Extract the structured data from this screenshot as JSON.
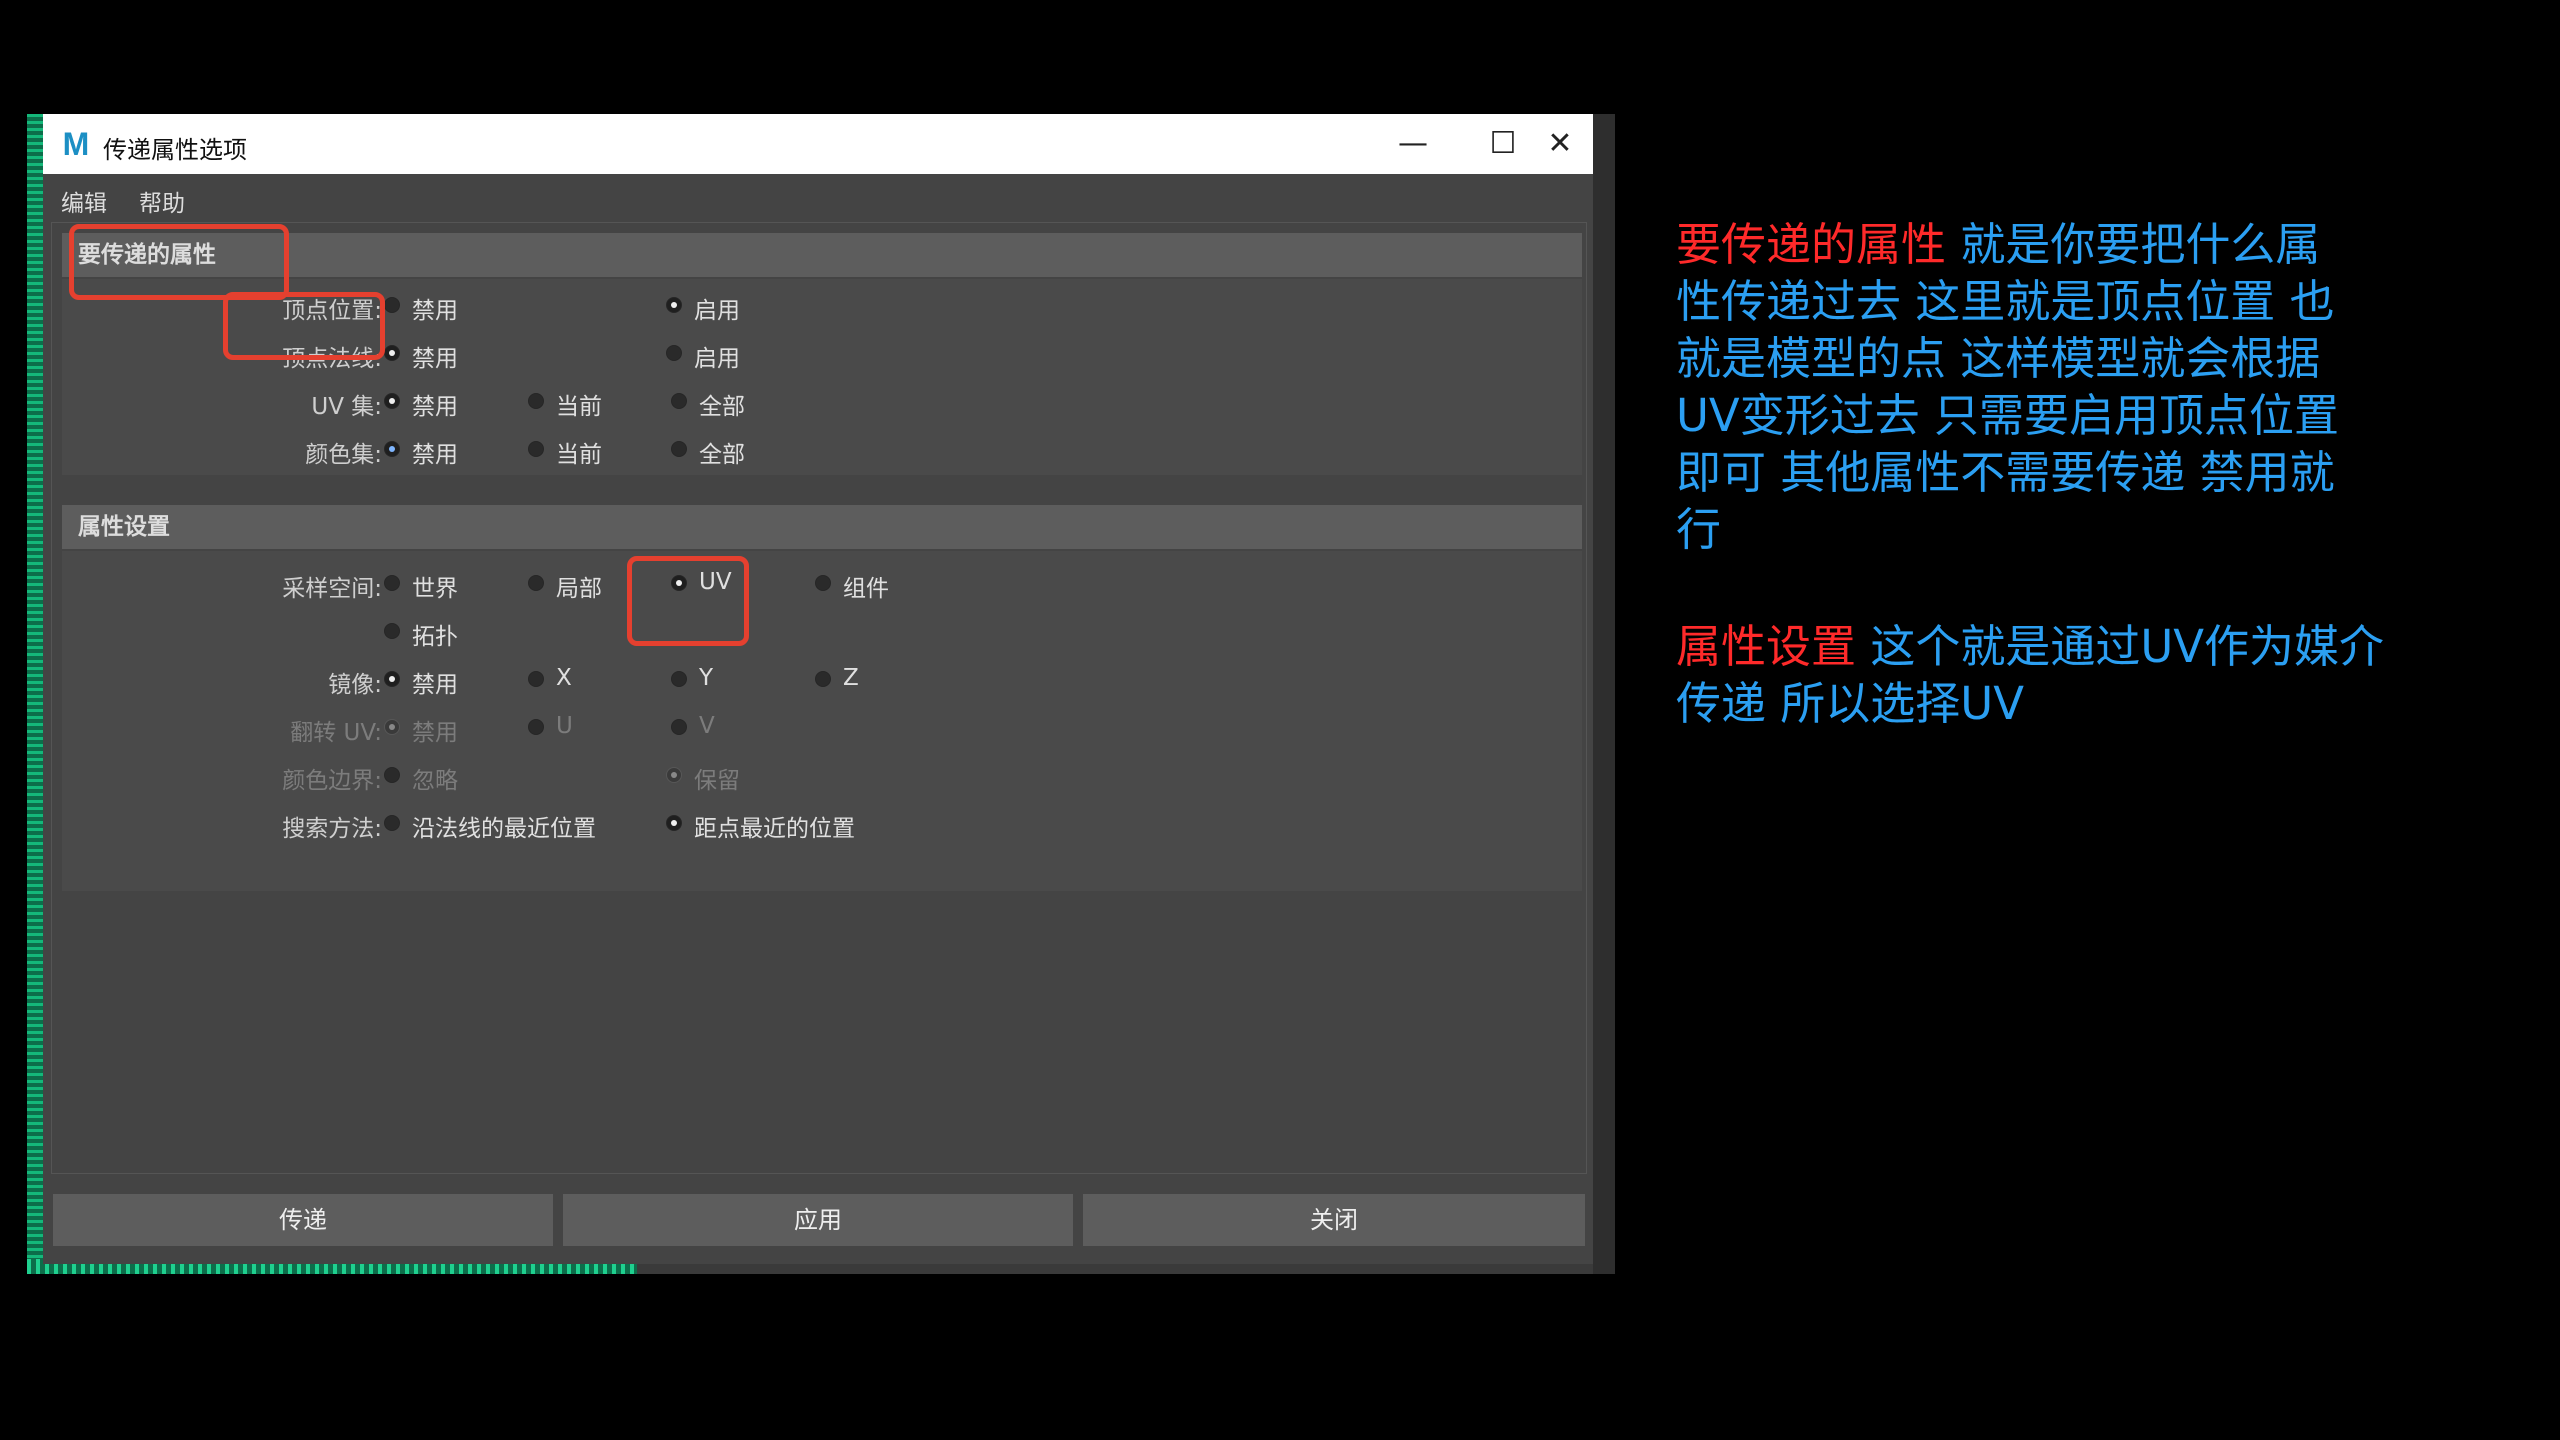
{
  "window": {
    "title": "传递属性选项",
    "app_icon_letter": "M",
    "controls": {
      "minimize": "—",
      "maximize": "☐",
      "close": "✕"
    }
  },
  "menu": {
    "edit": "编辑",
    "help": "帮助"
  },
  "section_transfer": {
    "header": "要传递的属性",
    "rows": [
      {
        "label": "顶点位置:",
        "options": [
          "禁用",
          "启用"
        ],
        "selected": "启用"
      },
      {
        "label": "顶点法线:",
        "options": [
          "禁用",
          "启用"
        ],
        "selected": "禁用"
      },
      {
        "label": "UV 集:",
        "options": [
          "禁用",
          "当前",
          "全部"
        ],
        "selected": "禁用"
      },
      {
        "label": "颜色集:",
        "options": [
          "禁用",
          "当前",
          "全部"
        ],
        "selected": "禁用"
      }
    ]
  },
  "section_settings": {
    "header": "属性设置",
    "rows": [
      {
        "label": "采样空间:",
        "options": [
          "世界",
          "局部",
          "UV",
          "组件",
          "拓扑"
        ],
        "selected": "UV"
      },
      {
        "label": "镜像:",
        "options": [
          "禁用",
          "X",
          "Y",
          "Z"
        ],
        "selected": "禁用"
      },
      {
        "label": "翻转 UV:",
        "options": [
          "禁用",
          "U",
          "V"
        ],
        "selected": "禁用",
        "disabled": true
      },
      {
        "label": "颜色边界:",
        "options": [
          "忽略",
          "保留"
        ],
        "selected": "保留",
        "disabled": true
      },
      {
        "label": "搜索方法:",
        "options": [
          "沿法线的最近位置",
          "距点最近的位置"
        ],
        "selected": "距点最近的位置"
      }
    ]
  },
  "buttons": {
    "transfer": "传递",
    "apply": "应用",
    "close": "关闭"
  },
  "annotations": {
    "note1_red": "要传递的属性",
    "note1_line1": " 就是你要把什么属",
    "note1_line2": "性传递过去 这里就是顶点位置 也",
    "note1_line3": "就是模型的点 这样模型就会根据",
    "note1_line4": "UV变形过去 只需要启用顶点位置",
    "note1_line5": "即可 其他属性不需要传递  禁用就",
    "note1_line6": "行",
    "note2_red": "属性设置",
    "note2_line1": "  这个就是通过UV作为媒介",
    "note2_line2": "传递 所以选择UV"
  },
  "colors": {
    "highlight": "#e5402f",
    "note_blue": "#2b9ff2",
    "note_red": "#ff2a2a",
    "app_icon": "#1c8fc4"
  }
}
